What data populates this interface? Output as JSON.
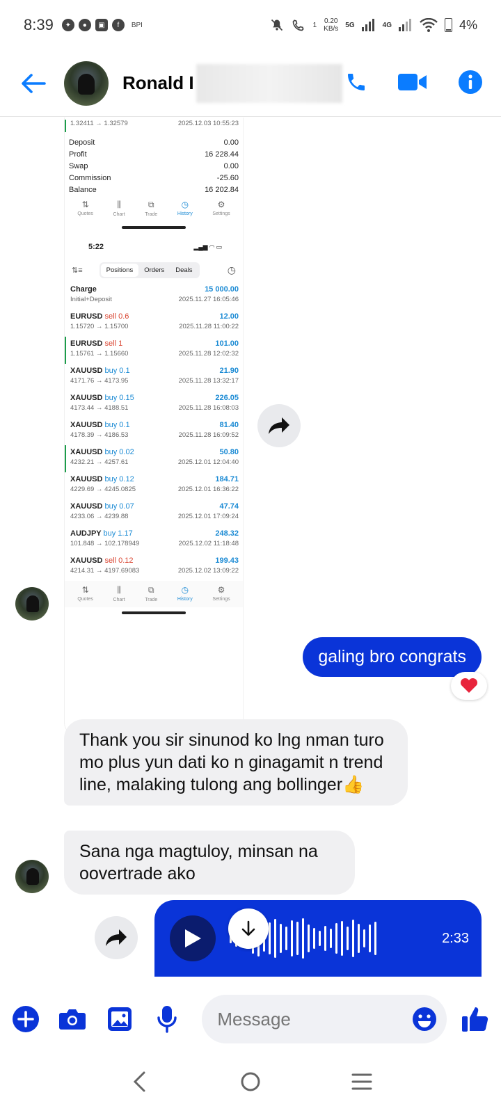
{
  "status": {
    "time": "8:39",
    "app_indicator": "BPI",
    "net_speed_value": "0.20",
    "net_speed_unit": "KB/s",
    "net_5g": "5G",
    "net_4g": "4G",
    "call_hd": "1",
    "battery": "4%"
  },
  "header": {
    "contact_name": "Ronald I",
    "back_icon": "arrow-left",
    "call_icon": "phone",
    "video_icon": "video-camera",
    "info_icon": "info",
    "accent": "#0a7cff"
  },
  "screenshot_card": {
    "partial_trade": {
      "prices": "1.32411 → 1.32579",
      "time": "2025.12.03 10:55:23"
    },
    "summary": [
      {
        "label": "Deposit",
        "value": "0.00"
      },
      {
        "label": "Profit",
        "value": "16 228.44"
      },
      {
        "label": "Swap",
        "value": "0.00"
      },
      {
        "label": "Commission",
        "value": "-25.60"
      },
      {
        "label": "Balance",
        "value": "16 202.84"
      }
    ],
    "tabs": [
      "Quotes",
      "Chart",
      "Trade",
      "History",
      "Settings"
    ],
    "active_tab": "History",
    "inner_time": "5:22",
    "segments": [
      "Positions",
      "Orders",
      "Deals"
    ],
    "charge": {
      "title": "Charge",
      "value": "15 000.00",
      "sub": "Initial+Deposit",
      "time": "2025.11.27 16:05:46"
    },
    "trades": [
      {
        "symbol": "EURUSD",
        "dir": "sell 0.6",
        "side": "sell",
        "value": "12.00",
        "prices": "1.15720 → 1.15700",
        "time": "2025.11.28 11:00:22",
        "mark": false
      },
      {
        "symbol": "EURUSD",
        "dir": "sell 1",
        "side": "sell",
        "value": "101.00",
        "prices": "1.15761 → 1.15660",
        "time": "2025.11.28 12:02:32",
        "mark": true
      },
      {
        "symbol": "XAUUSD",
        "dir": "buy 0.1",
        "side": "buy",
        "value": "21.90",
        "prices": "4171.76 → 4173.95",
        "time": "2025.11.28 13:32:17",
        "mark": false
      },
      {
        "symbol": "XAUUSD",
        "dir": "buy 0.15",
        "side": "buy",
        "value": "226.05",
        "prices": "4173.44 → 4188.51",
        "time": "2025.11.28 16:08:03",
        "mark": false
      },
      {
        "symbol": "XAUUSD",
        "dir": "buy 0.1",
        "side": "buy",
        "value": "81.40",
        "prices": "4178.39 → 4186.53",
        "time": "2025.11.28 16:09:52",
        "mark": false
      },
      {
        "symbol": "XAUUSD",
        "dir": "buy 0.02",
        "side": "buy",
        "value": "50.80",
        "prices": "4232.21 → 4257.61",
        "time": "2025.12.01 12:04:40",
        "mark": true
      },
      {
        "symbol": "XAUUSD",
        "dir": "buy 0.12",
        "side": "buy",
        "value": "184.71",
        "prices": "4229.69 → 4245.0825",
        "time": "2025.12.01 16:36:22",
        "mark": false
      },
      {
        "symbol": "XAUUSD",
        "dir": "buy 0.07",
        "side": "buy",
        "value": "47.74",
        "prices": "4233.06 → 4239.88",
        "time": "2025.12.01 17:09:24",
        "mark": false
      },
      {
        "symbol": "AUDJPY",
        "dir": "buy 1.17",
        "side": "buy",
        "value": "248.32",
        "prices": "101.848 → 102.178949",
        "time": "2025.12.02 11:18:48",
        "mark": false
      },
      {
        "symbol": "XAUUSD",
        "dir": "sell 0.12",
        "side": "sell",
        "value": "199.43",
        "prices": "4214.31 → 4197.69083",
        "time": "2025.12.02 13:09:22",
        "mark": false
      }
    ]
  },
  "messages": {
    "outgoing_1": "galing bro congrats",
    "reaction": "❤",
    "incoming_1": "Thank you sir sinunod ko lng nman turo mo plus yun dati ko n ginagamit n trend line, malaking tulong ang bollinger👍",
    "incoming_2": "Sana nga magtuloy, minsan na oovertrade ako",
    "voice_duration": "2:33",
    "outgoing_color": "#0a34d8"
  },
  "composer": {
    "placeholder": "Message",
    "icons": [
      "plus-icon",
      "camera-icon",
      "gallery-icon",
      "mic-icon",
      "emoji-icon",
      "thumbs-up-icon"
    ]
  }
}
